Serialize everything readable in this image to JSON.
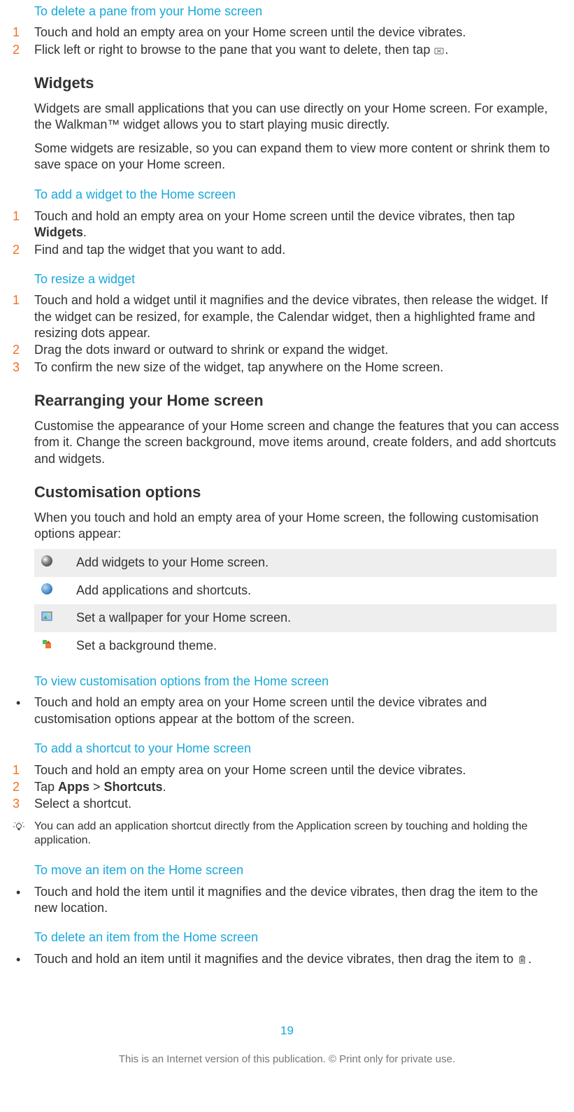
{
  "delete_pane": {
    "title": "To delete a pane from your Home screen",
    "step1": "Touch and hold an empty area on your Home screen until the device vibrates.",
    "step2a": "Flick left or right to browse to the pane that you want to delete, then tap ",
    "step2b": "."
  },
  "widgets": {
    "title": "Widgets",
    "p1": "Widgets are small applications that you can use directly on your Home screen. For example, the Walkman™ widget allows you to start playing music directly.",
    "p2": "Some widgets are resizable, so you can expand them to view more content or shrink them to save space on your Home screen."
  },
  "add_widget": {
    "title": "To add a widget to the Home screen",
    "step1a": "Touch and hold an empty area on your Home screen until the device vibrates, then tap ",
    "step1b": "Widgets",
    "step1c": ".",
    "step2": "Find and tap the widget that you want to add."
  },
  "resize_widget": {
    "title": "To resize a widget",
    "step1": "Touch and hold a widget until it magnifies and the device vibrates, then release the widget. If the widget can be resized, for example, the Calendar widget, then a highlighted frame and resizing dots appear.",
    "step2": "Drag the dots inward or outward to shrink or expand the widget.",
    "step3": "To confirm the new size of the widget, tap anywhere on the Home screen."
  },
  "rearranging": {
    "title": "Rearranging your Home screen",
    "p1": "Customise the appearance of your Home screen and change the features that you can access from it. Change the screen background, move items around, create folders, and add shortcuts and widgets."
  },
  "customisation": {
    "title": "Customisation options",
    "p1": "When you touch and hold an empty area of your Home screen, the following customisation options appear:",
    "opt1": "Add widgets to your Home screen.",
    "opt2": "Add applications and shortcuts.",
    "opt3": "Set a wallpaper for your Home screen.",
    "opt4": "Set a background theme."
  },
  "view_customisation": {
    "title": "To view customisation options from the Home screen",
    "bullet1": "Touch and hold an empty area on your Home screen until the device vibrates and customisation options appear at the bottom of the screen."
  },
  "add_shortcut": {
    "title": "To add a shortcut to your Home screen",
    "step1": "Touch and hold an empty area on your Home screen until the device vibrates.",
    "step2a": "Tap ",
    "step2b": "Apps",
    "step2c": " > ",
    "step2d": "Shortcuts",
    "step2e": ".",
    "step3": "Select a shortcut.",
    "tip": "You can add an application shortcut directly from the Application screen by touching and holding the application."
  },
  "move_item": {
    "title": "To move an item on the Home screen",
    "bullet1": "Touch and hold the item until it magnifies and the device vibrates, then drag the item to the new location."
  },
  "delete_item": {
    "title": "To delete an item from the Home screen",
    "bullet1a": "Touch and hold an item until it magnifies and the device vibrates, then drag the item to ",
    "bullet1b": "."
  },
  "page_number": "19",
  "footer": "This is an Internet version of this publication. © Print only for private use."
}
